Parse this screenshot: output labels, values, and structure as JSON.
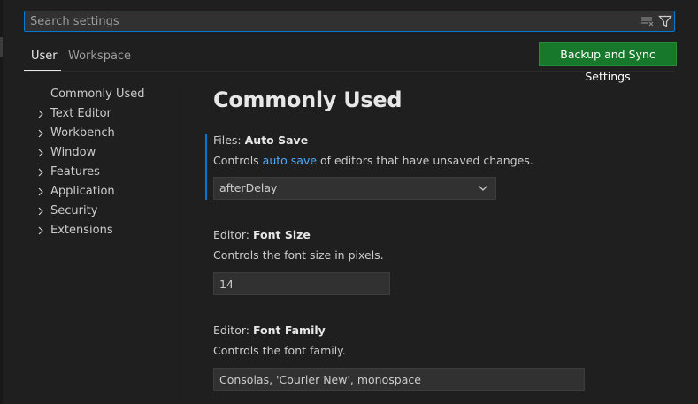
{
  "search": {
    "placeholder": "Search settings"
  },
  "tabs": [
    {
      "label": "User"
    },
    {
      "label": "Workspace"
    }
  ],
  "sync_button": {
    "label": "Backup and Sync Settings"
  },
  "toc": {
    "items": [
      {
        "label": "Commonly Used",
        "expandable": false
      },
      {
        "label": "Text Editor",
        "expandable": true
      },
      {
        "label": "Workbench",
        "expandable": true
      },
      {
        "label": "Window",
        "expandable": true
      },
      {
        "label": "Features",
        "expandable": true
      },
      {
        "label": "Application",
        "expandable": true
      },
      {
        "label": "Security",
        "expandable": true
      },
      {
        "label": "Extensions",
        "expandable": true
      }
    ]
  },
  "section": {
    "title": "Commonly Used"
  },
  "settings": {
    "auto_save": {
      "category": "Files: ",
      "name": "Auto Save",
      "desc_before": "Controls ",
      "desc_link": "auto save",
      "desc_after": " of editors that have unsaved changes.",
      "value": "afterDelay"
    },
    "font_size": {
      "category": "Editor: ",
      "name": "Font Size",
      "desc": "Controls the font size in pixels.",
      "value": "14"
    },
    "font_family": {
      "category": "Editor: ",
      "name": "Font Family",
      "desc": "Controls the font family.",
      "value": "Consolas, 'Courier New', monospace"
    }
  },
  "colors": {
    "accent": "#0078d4",
    "sync_button_bg": "#17772a",
    "link": "#4daafc",
    "background": "#1f1f1f"
  },
  "icons": {
    "clear": "clear-filter-icon",
    "filter": "filter-icon",
    "chevron_right": "chevron-right-icon",
    "chevron_down": "chevron-down-icon"
  }
}
